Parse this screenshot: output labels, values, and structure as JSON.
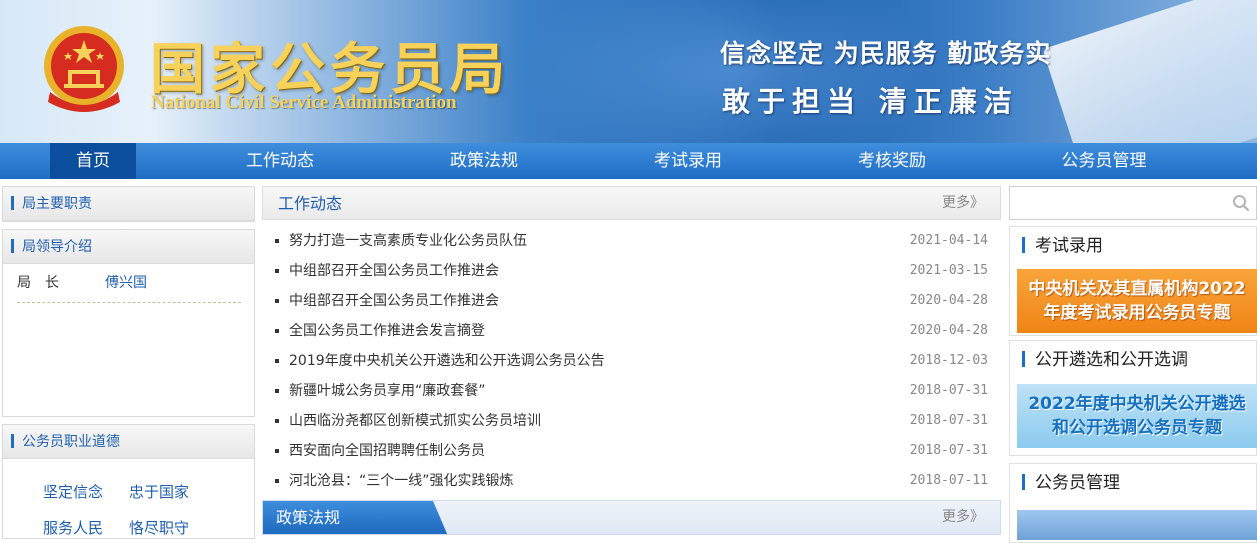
{
  "header": {
    "title_cn": "国家公务员局",
    "title_en": "National Civil Service Administration",
    "slogan_line1": "信念坚定  为民服务  勤政务实",
    "slogan_line2": "敢于担当   清正廉洁"
  },
  "nav": [
    {
      "label": "首页",
      "active": true
    },
    {
      "label": "工作动态"
    },
    {
      "label": "政策法规"
    },
    {
      "label": "考试录用"
    },
    {
      "label": "考核奖励"
    },
    {
      "label": "公务员管理"
    }
  ],
  "left": {
    "duties_title": "局主要职责",
    "leaders_title": "局领导介绍",
    "leader": {
      "role": "局　长",
      "name": "傅兴国"
    },
    "ethics_title": "公务员职业道德",
    "ethics": [
      "坚定信念",
      "忠于国家",
      "服务人民",
      "恪尽职守"
    ]
  },
  "work_news": {
    "title": "工作动态",
    "more": "更多》",
    "items": [
      {
        "title": "努力打造一支高素质专业化公务员队伍",
        "date": "2021-04-14"
      },
      {
        "title": "中组部召开全国公务员工作推进会",
        "date": "2021-03-15"
      },
      {
        "title": "中组部召开全国公务员工作推进会",
        "date": "2020-04-28"
      },
      {
        "title": "全国公务员工作推进会发言摘登",
        "date": "2020-04-28"
      },
      {
        "title": "2019年度中央机关公开遴选和公开选调公务员公告",
        "date": "2018-12-03"
      },
      {
        "title": "新疆叶城公务员享用“廉政套餐”",
        "date": "2018-07-31"
      },
      {
        "title": "山西临汾尧都区创新模式抓实公务员培训",
        "date": "2018-07-31"
      },
      {
        "title": "西安面向全国招聘聘任制公务员",
        "date": "2018-07-31"
      },
      {
        "title": "河北沧县：“三个一线”强化实践锻炼",
        "date": "2018-07-11"
      }
    ]
  },
  "policy": {
    "title": "政策法规",
    "more": "更多》"
  },
  "right": {
    "search_placeholder": "",
    "exam": {
      "title": "考试录用",
      "banner": [
        "中央机关及其直属机构2022",
        "年度考试录用公务员专题"
      ]
    },
    "transfer": {
      "title": "公开遴选和公开选调",
      "banner": [
        "2022年度中央机关公开遴选",
        "和公开选调公务员专题"
      ]
    },
    "manage": {
      "title": "公务员管理"
    }
  },
  "colors": {
    "nav_blue": "#2a7fd3",
    "nav_active": "#0c4e9e",
    "title_gold": "#f6d25a",
    "link_blue": "#1f5fae"
  }
}
